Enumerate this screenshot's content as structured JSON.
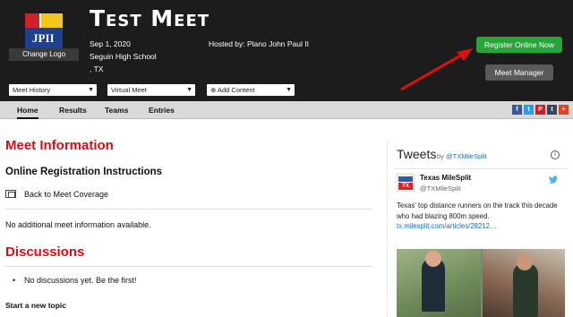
{
  "header": {
    "title": "Test Meet",
    "date": "Sep 1, 2020",
    "host": "Hosted by: Plano John Paul II",
    "school": "Seguin High School",
    "location": ", TX",
    "change_logo": "Change Logo",
    "logo_text": "JPII",
    "register_button": "Register Online Now",
    "manager_button": "Meet Manager",
    "dropdowns": [
      "Meet History",
      "Virtual Meet",
      "Add Content"
    ],
    "accent_color": "#2aa33a"
  },
  "nav": {
    "items": [
      "Home",
      "Results",
      "Teams",
      "Entries"
    ],
    "active": "Home",
    "share_icons": [
      "facebook-icon",
      "twitter-icon",
      "pinterest-icon",
      "tumblr-icon",
      "more-share-icon"
    ],
    "share_glyphs": [
      "f",
      "t",
      "P",
      "t",
      "+"
    ]
  },
  "main": {
    "meet_info_heading": "Meet Information",
    "online_reg_heading": "Online Registration Instructions",
    "back_link": "Back to Meet Coverage",
    "no_info": "No additional meet information available.",
    "discussions_heading": "Discussions",
    "no_discussions": "No discussions yet. Be the first!",
    "start_topic": "Start a new topic"
  },
  "tweets": {
    "heading": "Tweets",
    "by": "by",
    "handle_link": "@TXMileSplit",
    "author_name": "Texas MileSplit",
    "author_handle": "@TXMileSplit",
    "avatar_text": "TX",
    "text": "Texas' top distance runners on the track this decade who had blazing 800m speed.",
    "link": "tx.milesplit.com/articles/28212…",
    "info_glyph": "i"
  }
}
